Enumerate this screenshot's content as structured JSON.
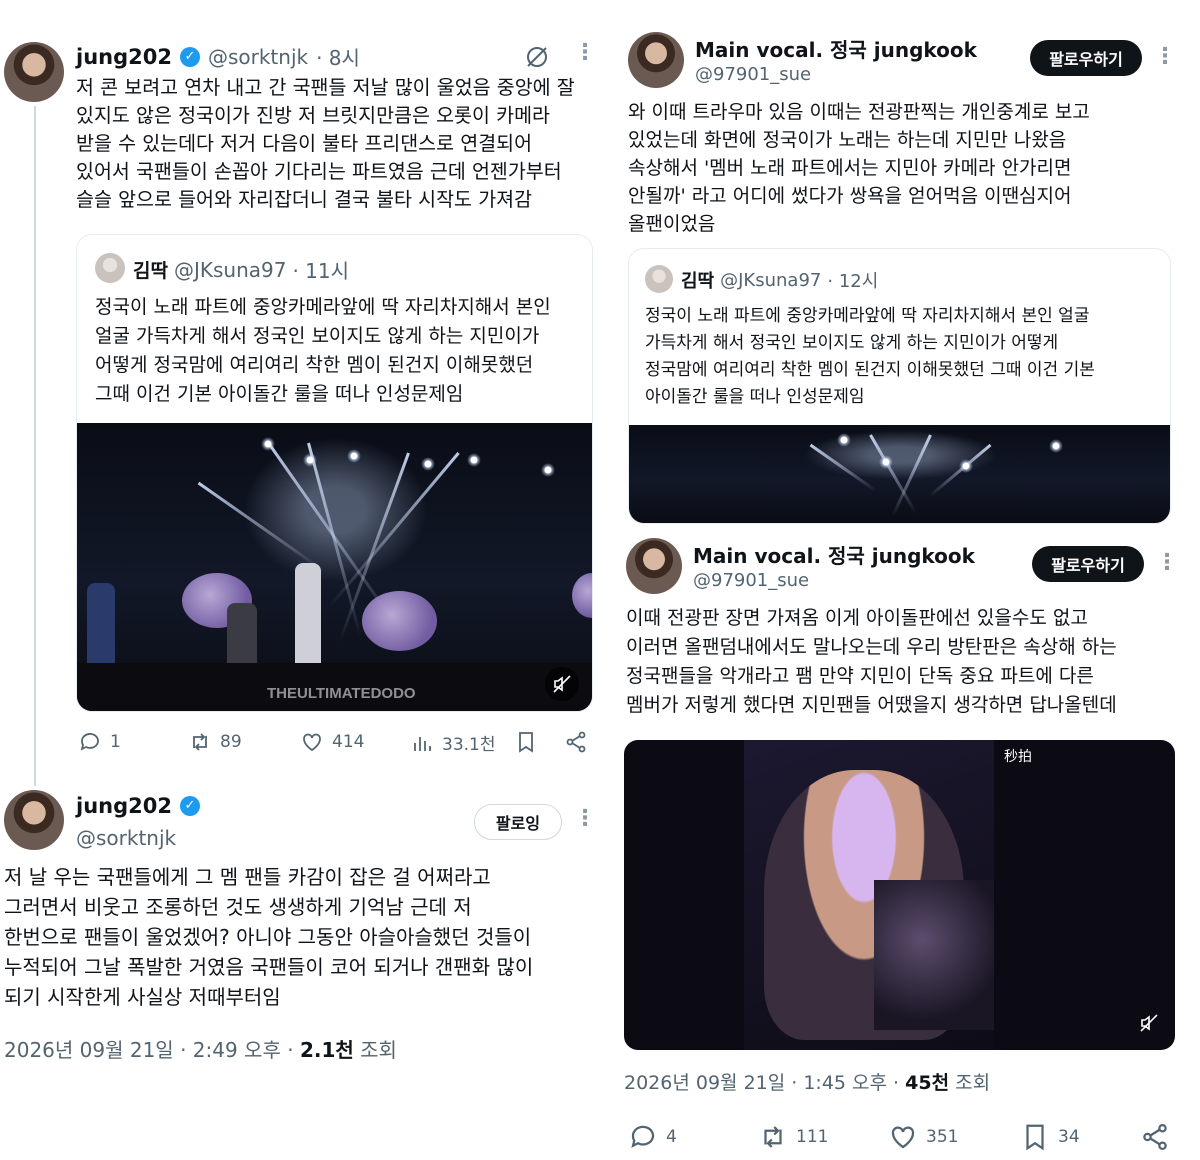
{
  "colors": {
    "accent": "#1d9bf0",
    "text": "#0f1419",
    "muted": "#536471",
    "border": "#e6ecf0"
  },
  "left": {
    "tweet1": {
      "name": "jung202",
      "handle": "@sorktnjk",
      "time": "· 8시",
      "lines": [
        "저 콘 보려고 연차 내고 간 국팬들 저날 많이 울었음 중앙에 잘",
        "있지도 않은 정국이가 진방 저 브릿지만큼은 오롯이 카메라",
        "받을 수 있는데다 저거 다음이 불타 프리댄스로 연결되어",
        "있어서 국팬들이 손꼽아 기다리는 파트였음 근데 언젠가부터",
        "슬슬 앞으로 들어와 자리잡더니 결국 불타 시작도 가져감"
      ],
      "quote": {
        "name": "김딱",
        "handle": "@JKsuna97",
        "time": "· 11시",
        "lines": [
          "정국이 노래 파트에 중앙카메라앞에 딱 자리차지해서 본인",
          "얼굴 가득차게 해서 정국인 보이지도 않게 하는 지민이가",
          "어떻게 정국맘에 여리여리 착한 멤이 된건지 이해못했던",
          "그때 이건 기본 아이돌간 룰을 떠나 인성문제임"
        ],
        "watermark": "THEULTIMATEDODO"
      },
      "actions": {
        "replies": "1",
        "retweets": "89",
        "likes": "414",
        "views": "33.1천"
      }
    },
    "tweet2": {
      "name": "jung202",
      "handle": "@sorktnjk",
      "follow_label": "팔로잉",
      "lines": [
        "저 날 우는 국팬들에게 그 멤 팬들 카감이 잡은 걸 어쩌라고",
        "그러면서 비웃고 조롱하던 것도 생생하게 기억남 근데 저",
        "한번으로 팬들이 울었겠어? 아니야 그동안 아슬아슬했던 것들이",
        "누적되어 그날 폭발한 거였음 국팬들이 코어 되거나 갠팬화 많이",
        "되기 시작한게 사실상 저때부터임"
      ],
      "date": "2026년 09월 21일 · 2:49 오후 ·",
      "views": "2.1천",
      "views_label": "조회"
    }
  },
  "right": {
    "tweet1": {
      "name": "Main vocal. 정국 jungkook",
      "handle": "@97901_sue",
      "follow_label": "팔로우하기",
      "lines": [
        "와 이때 트라우마 있음 이때는 전광판찍는 개인중계로 보고",
        "있었는데 화면에 정국이가 노래는 하는데 지민만 나왔음",
        "속상해서 '멤버 노래 파트에서는 지민아 카메라 안가리면",
        "안될까' 라고 어디에 썼다가 쌍욕을 얻어먹음 이땐심지어",
        "올팬이었음"
      ],
      "quote": {
        "name": "김딱",
        "handle": "@JKsuna97",
        "time": "· 12시",
        "lines": [
          "정국이 노래 파트에 중앙카메라앞에 딱 자리차지해서 본인 얼굴",
          "가득차게 해서 정국인 보이지도 않게 하는 지민이가 어떻게",
          "정국맘에 여리여리 착한 멤이 된건지 이해못했던 그때 이건 기본",
          "아이돌간 룰을 떠나 인성문제임"
        ]
      }
    },
    "tweet2": {
      "name": "Main vocal. 정국 jungkook",
      "handle": "@97901_sue",
      "follow_label": "팔로우하기",
      "lines": [
        "이때 전광판 장면 가져옴 이게 아이돌판에선 있을수도 없고",
        "이러면 올팬덤내에서도 말나오는데 우리 방탄판은 속상해 하는",
        "정국팬들을 악개라고 팸 만약 지민이 단독 중요 파트에 다른",
        "멤버가 저렇게 했다면 지민팬들 어땠을지 생각하면  답나올텐데"
      ],
      "video_logo": "秒拍",
      "date": "2026년 09월 21일 · 1:45 오후 ·",
      "views": "45천",
      "views_label": "조회",
      "actions": {
        "replies": "4",
        "retweets": "111",
        "likes": "351",
        "bookmarks": "34"
      }
    }
  }
}
